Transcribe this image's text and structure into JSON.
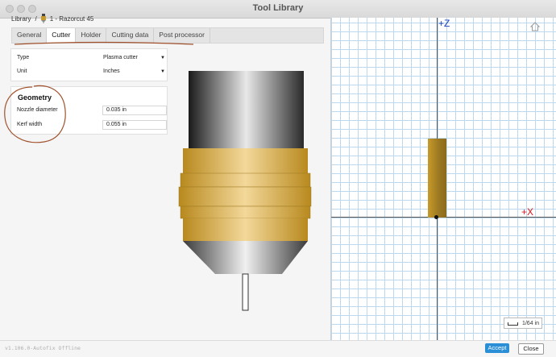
{
  "window": {
    "title": "Tool Library"
  },
  "breadcrumb": {
    "root": "Library",
    "separator": "/",
    "current": "1 - Razorcut 45"
  },
  "tabs": [
    {
      "label": "General"
    },
    {
      "label": "Cutter"
    },
    {
      "label": "Holder"
    },
    {
      "label": "Cutting data"
    },
    {
      "label": "Post processor"
    }
  ],
  "active_tab": "Cutter",
  "cutter": {
    "type_label": "Type",
    "type_value": "Plasma cutter",
    "unit_label": "Unit",
    "unit_value": "Inches"
  },
  "geometry": {
    "heading": "Geometry",
    "nozzle_label": "Nozzle diameter",
    "nozzle_value": "0.035 in",
    "kerf_label": "Kerf width",
    "kerf_value": "0.055 in"
  },
  "viewport": {
    "z_label": "+Z",
    "x_label": "+X",
    "scale_label": "1/64 in"
  },
  "footer": {
    "version": "v1.106.0-Autofix Offline",
    "accept_label": "Accept",
    "close_label": "Close"
  },
  "colors": {
    "brass": "#d4a332",
    "accent": "#2a8fd6",
    "annotation": "#a0522d",
    "z_axis": "#1a3fbf",
    "x_axis": "#e0141b"
  }
}
